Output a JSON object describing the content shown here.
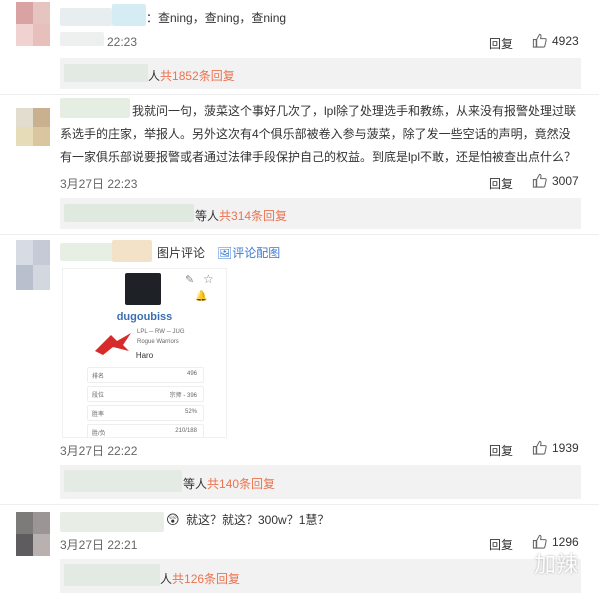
{
  "comments": [
    {
      "text": "：查ning，查ning，查ning",
      "time": "22:23",
      "reply_label": "回复",
      "likes": "4923",
      "sub_prefix": "人",
      "sub_count": "共1852条回复"
    },
    {
      "text_line1": "我就问一句，菠菜这个事好几次了，lpl除了处理选手和教练，从来没有报警处理过联",
      "text_line2": "系选手的庄家，举报人。另外这次有4个俱乐部被卷入参与菠菜，除了发一些空话的声明，竟然没",
      "text_line3": "有一家俱乐部说要报警或者通过法律手段保护自己的权益。到底是lpl不敢，还是怕被查出点什么？",
      "time": "3月27日 22:23",
      "reply_label": "回复",
      "likes": "3007",
      "sub_prefix": "等人",
      "sub_count": "共314条回复"
    },
    {
      "pic_label": "图片评论",
      "pic_link": "评论配图",
      "time": "3月27日 22:22",
      "reply_label": "回复",
      "likes": "1939",
      "sub_prefix": "等人",
      "sub_count": "共140条回复"
    },
    {
      "text": "就这？就这？300w？1慧？",
      "time": "3月27日 22:21",
      "reply_label": "回复",
      "likes": "1296",
      "sub_prefix": "人",
      "sub_count": "共126条回复"
    }
  ],
  "card": {
    "username": "dugoubiss",
    "meta": "LPL ─ RW ─ JUG",
    "team": "Rogue Warriors",
    "name": "Haro",
    "rows": [
      {
        "k": "排名",
        "v": "496"
      },
      {
        "k": "段位",
        "v": "宗师 - 396"
      },
      {
        "k": "胜率",
        "v": "52%"
      },
      {
        "k": "胜/负",
        "v": "210/188"
      }
    ]
  },
  "watermark": "加辣",
  "colors": {
    "accent": "#eb7350",
    "link": "#3c7bd1",
    "bar": "#f2f2f2"
  }
}
